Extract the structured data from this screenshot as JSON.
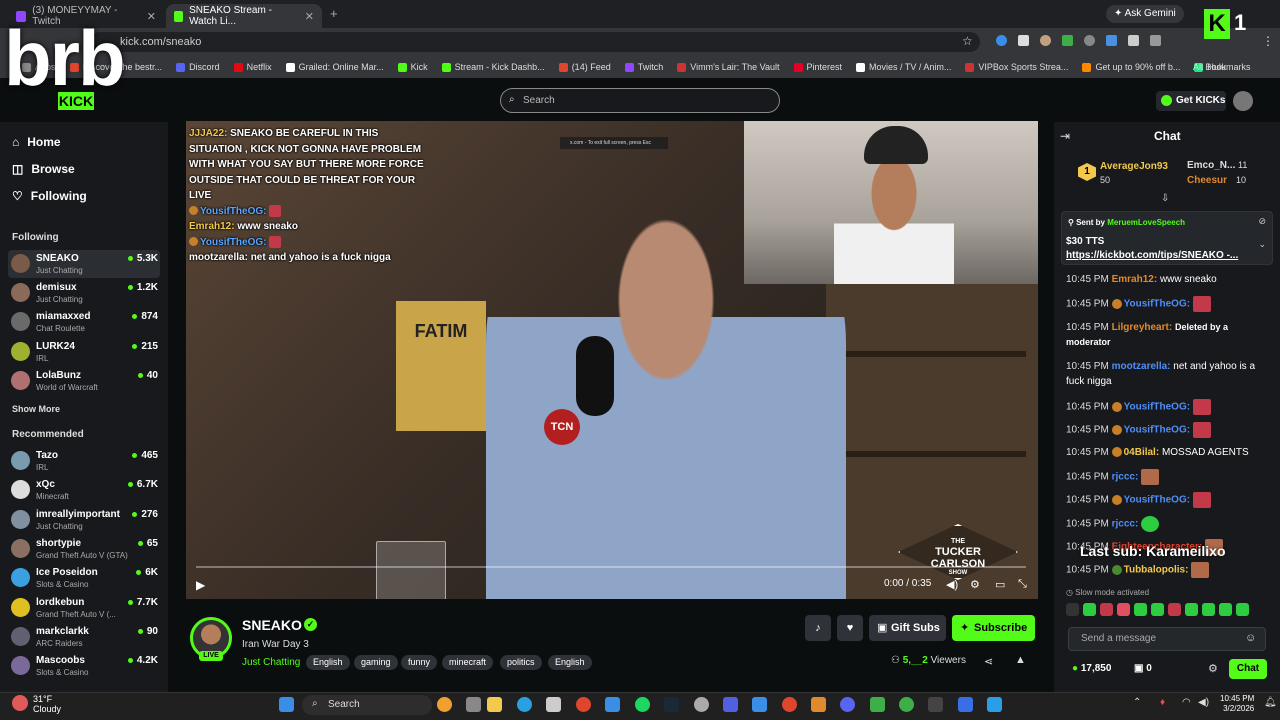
{
  "browser": {
    "tabs": [
      {
        "title": "(3) MONEYYMAY - Twitch",
        "active": false,
        "color": "#9146ff"
      },
      {
        "title": "SNEAKO Stream - Watch Li...",
        "active": true,
        "color": "#53fc18"
      }
    ],
    "url": "kick.com/sneako",
    "gemini_label": "Ask Gemini",
    "bookmarks": [
      {
        "label": "Apps",
        "color": "#888888"
      },
      {
        "label": "Discover the bestr...",
        "color": "#e0452e"
      },
      {
        "label": "Discord",
        "color": "#5865f2"
      },
      {
        "label": "Netflix",
        "color": "#e50914"
      },
      {
        "label": "Grailed: Online Mar...",
        "color": "#ffffff"
      },
      {
        "label": "Kick",
        "color": "#53fc18"
      },
      {
        "label": "Stream - Kick Dashb...",
        "color": "#53fc18"
      },
      {
        "label": "(14) Feed",
        "color": "#e0452e"
      },
      {
        "label": "Twitch",
        "color": "#9146ff"
      },
      {
        "label": "Vimm's Lair: The Vault",
        "color": "#cc3333"
      },
      {
        "label": "Pinterest",
        "color": "#e60023"
      },
      {
        "label": "Movies / TV / Anim...",
        "color": "#ffffff"
      },
      {
        "label": "VIPBox Sports Strea...",
        "color": "#cc3333"
      },
      {
        "label": "Get up to 90% off b...",
        "color": "#ff8800"
      },
      {
        "label": "Hulu",
        "color": "#1ce783"
      }
    ],
    "all_bookmarks": "All Bookmarks"
  },
  "overlay": {
    "brb": "brb",
    "corner_number": "1",
    "corner_logo": "K"
  },
  "header": {
    "search_placeholder": "Search",
    "get_kicks": "Get KICKs"
  },
  "sidebar": {
    "nav": [
      {
        "label": "Home",
        "icon": "home-icon"
      },
      {
        "label": "Browse",
        "icon": "browse-icon"
      },
      {
        "label": "Following",
        "icon": "heart-icon"
      }
    ],
    "following_heading": "Following",
    "following": [
      {
        "name": "SNEAKO",
        "category": "Just Chatting",
        "viewers": "5.3K",
        "color": "#7a5a48",
        "selected": true
      },
      {
        "name": "demisux",
        "category": "Just Chatting",
        "viewers": "1.2K",
        "color": "#8a6a58"
      },
      {
        "name": "miamaxxed",
        "category": "Chat Roulette",
        "viewers": "874",
        "color": "#6a6a6a"
      },
      {
        "name": "LURK24",
        "category": "IRL",
        "viewers": "215",
        "color": "#a0b030"
      },
      {
        "name": "LolaBunz",
        "category": "World of Warcraft",
        "viewers": "40",
        "color": "#b07070"
      }
    ],
    "show_more": "Show More",
    "recommended_heading": "Recommended",
    "recommended": [
      {
        "name": "Tazo",
        "category": "IRL",
        "viewers": "465",
        "color": "#7a9ab0"
      },
      {
        "name": "xQc",
        "category": "Minecraft",
        "viewers": "6.7K",
        "color": "#dddddd"
      },
      {
        "name": "imreallyimportant",
        "category": "Just Chatting",
        "viewers": "276",
        "color": "#8090a0"
      },
      {
        "name": "shortypie",
        "category": "Grand Theft Auto V (GTA)",
        "viewers": "65",
        "color": "#8a7060"
      },
      {
        "name": "Ice Poseidon",
        "category": "Slots & Casino",
        "viewers": "6K",
        "color": "#3aa0e0"
      },
      {
        "name": "lordkebun",
        "category": "Grand Theft Auto V (...",
        "viewers": "7.7K",
        "color": "#e0c020"
      },
      {
        "name": "markclarkk",
        "category": "ARC Raiders",
        "viewers": "90",
        "color": "#606070"
      },
      {
        "name": "Mascoobs",
        "category": "Slots & Casino",
        "viewers": "4.2K",
        "color": "#7a6a9a"
      }
    ]
  },
  "player": {
    "exit_fullscreen_hint": "x.com - To exit full screen, press Esc",
    "overlay_chat": [
      {
        "user": "JJJA22:",
        "text": "SNEAKO BE CAREFUL IN THIS SITUATION , KICK NOT GONNA HAVE PROBLEM WITH WHAT YOU SAY BUT THERE MORE FORCE OUTSIDE THAT COULD BE THREAT FOR YOUR LIVE",
        "style": "gold"
      },
      {
        "user": "YousifTheOG:",
        "text": "",
        "style": "blue"
      },
      {
        "user": "Emrah12:",
        "text": "www sneako",
        "style": "gold"
      },
      {
        "user": "YousifTheOG:",
        "text": "",
        "style": "blue"
      },
      {
        "user": "mootzarella:",
        "text": "net and yahoo is a fuck nigga",
        "style": "white"
      }
    ],
    "fatima_sign": "FATIM",
    "mic_badge": "TCN",
    "logo_lines": [
      "THE",
      "TUCKER",
      "CARLSON",
      "SHOW"
    ],
    "timecode": "0:00 / 0:35"
  },
  "stream_info": {
    "channel": "SNEAKO",
    "live_label": "LIVE",
    "title": "Iran War Day 3",
    "category": "Just Chatting",
    "tags": [
      "English",
      "gaming",
      "funny",
      "minecraft",
      "politics",
      "English"
    ],
    "gift_subs": "Gift Subs",
    "subscribe": "Subscribe",
    "viewers_count": "5,__2",
    "viewers_label": "Viewers"
  },
  "chat": {
    "title": "Chat",
    "leaderboard": [
      {
        "rank": "1",
        "name": "AverageJon93",
        "value": "50",
        "color": "#f2c94c"
      },
      {
        "name": "Emco_N...",
        "value": "11",
        "color": "#dddddd"
      },
      {
        "name": "Cheesur",
        "value": "10",
        "color": "#e08a2e"
      }
    ],
    "pinned": {
      "sent_by": "Sent by",
      "sender": "MeruemLoveSpeech",
      "amount": "$30 TTS",
      "link": "https://kickbot.com/tips/SNEAKO -..."
    },
    "messages": [
      {
        "time": "10:45 PM",
        "user": "Emrah12:",
        "text": "www sneako",
        "color": "#e08a2e",
        "badge": false,
        "emote": false
      },
      {
        "time": "10:45 PM",
        "user": "YousifTheOG:",
        "text": "",
        "color": "#4f8ef7",
        "badge": true,
        "emote": true
      },
      {
        "time": "10:45 PM",
        "user": "Lilgreyheart:",
        "text": "Deleted by a moderator",
        "color": "#e08a2e",
        "badge": false,
        "emote": false,
        "deleted": true
      },
      {
        "time": "10:45 PM",
        "user": "mootzarella:",
        "text": "net and yahoo is a fuck nigga",
        "color": "#4f8ef7",
        "badge": false,
        "emote": false
      },
      {
        "time": "10:45 PM",
        "user": "YousifTheOG:",
        "text": "",
        "color": "#4f8ef7",
        "badge": true,
        "emote": true
      },
      {
        "time": "10:45 PM",
        "user": "YousifTheOG:",
        "text": "",
        "color": "#4f8ef7",
        "badge": true,
        "emote": true
      },
      {
        "time": "10:45 PM",
        "user": "04Bilal:",
        "text": "MOSSAD AGENTS",
        "color": "#f2c94c",
        "badge": true,
        "emote": false
      },
      {
        "time": "10:45 PM",
        "user": "rjccc:",
        "text": "",
        "color": "#4f8ef7",
        "badge": false,
        "emote": true
      },
      {
        "time": "10:45 PM",
        "user": "YousifTheOG:",
        "text": "",
        "color": "#4f8ef7",
        "badge": true,
        "emote": true
      },
      {
        "time": "10:45 PM",
        "user": "rjccc:",
        "text": "",
        "color": "#4f8ef7",
        "badge": false,
        "emote": true
      },
      {
        "time": "10:45 PM",
        "user": "Eighteencharacter:",
        "text": "",
        "color": "#e0452e",
        "badge": false,
        "emote": true
      },
      {
        "time": "10:45 PM",
        "user": "Tubbalopolis:",
        "text": "",
        "color": "#f2c94c",
        "badge": true,
        "emote": true
      }
    ],
    "last_sub": "Last sub: Karameilixo",
    "slow_mode": "Slow mode activated",
    "input_placeholder": "Send a message",
    "kicks_balance": "17,850",
    "gift_count": "0",
    "chat_button": "Chat"
  },
  "taskbar": {
    "weather_temp": "31°F",
    "weather_desc": "Cloudy",
    "search_label": "Search",
    "time": "10:45 PM",
    "date": "3/2/2026"
  }
}
